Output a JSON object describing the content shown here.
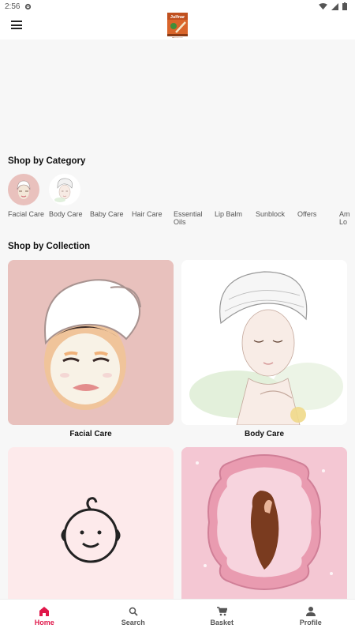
{
  "status": {
    "time": "2:56"
  },
  "app": {
    "brand": "Julfnar",
    "brand_sub": "Pharmacy"
  },
  "categories": {
    "title": "Shop by Category",
    "items": [
      {
        "label": "Facial Care"
      },
      {
        "label": "Body Care"
      },
      {
        "label": "Baby Care"
      },
      {
        "label": "Hair Care"
      },
      {
        "label": "Essential Oils"
      },
      {
        "label": "Lip Balm"
      },
      {
        "label": "Sunblock"
      },
      {
        "label": "Offers"
      },
      {
        "label": "Am Lo"
      }
    ]
  },
  "collections": {
    "title": "Shop by Collection",
    "items": [
      {
        "label": "Facial Care"
      },
      {
        "label": "Body Care"
      },
      {
        "label": ""
      },
      {
        "label": ""
      }
    ]
  },
  "nav": {
    "items": [
      {
        "label": "Home",
        "icon": "home-icon"
      },
      {
        "label": "Search",
        "icon": "search-icon"
      },
      {
        "label": "Basket",
        "icon": "cart-icon"
      },
      {
        "label": "Profile",
        "icon": "person-icon"
      }
    ],
    "active_color": "#e0174a"
  }
}
